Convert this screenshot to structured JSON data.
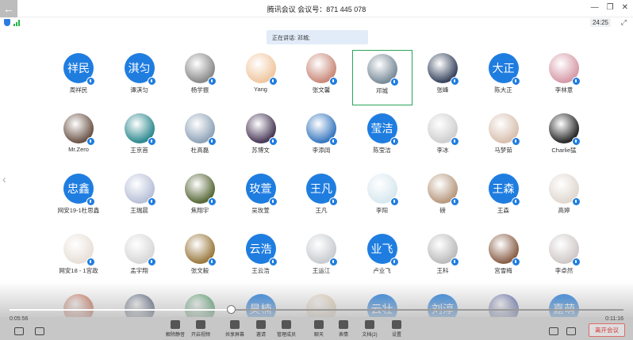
{
  "window": {
    "title": "腾讯会议 会议号：871 445 078",
    "timer": "24:25",
    "controls": [
      "—",
      "❐",
      "✕"
    ]
  },
  "speaking_banner": "正在讲话: 邓城;",
  "colors": {
    "accent": "#1f7de0",
    "active_border": "#2aa55a",
    "leave": "#d23a3a"
  },
  "participants": [
    {
      "name": "周祥民",
      "avatar_text": "祥民",
      "photo": null
    },
    {
      "name": "谭淇匀",
      "avatar_text": "淇匀",
      "photo": null
    },
    {
      "name": "杨学振",
      "avatar_text": "",
      "photo": "#8a8a8a"
    },
    {
      "name": "Yang",
      "avatar_text": "",
      "photo": "#f0c7a0"
    },
    {
      "name": "张文馨",
      "avatar_text": "",
      "photo": "#c98a7a"
    },
    {
      "name": "邓城",
      "avatar_text": "",
      "photo": "#7a8c9a",
      "active": true
    },
    {
      "name": "张峰",
      "avatar_text": "",
      "photo": "#3a4660"
    },
    {
      "name": "陈大正",
      "avatar_text": "大正",
      "photo": null
    },
    {
      "name": "李林意",
      "avatar_text": "",
      "photo": "#d69aa8"
    },
    {
      "name": "Mr.Zero",
      "avatar_text": "",
      "photo": "#6c5548"
    },
    {
      "name": "王京首",
      "avatar_text": "",
      "photo": "#2f8a90"
    },
    {
      "name": "杜高磊",
      "avatar_text": "",
      "photo": "#8fa3b8"
    },
    {
      "name": "苏博文",
      "avatar_text": "",
      "photo": "#4a3a58"
    },
    {
      "name": "李添阔",
      "avatar_text": "",
      "photo": "#3a78c0"
    },
    {
      "name": "陈莹洁",
      "avatar_text": "莹洁",
      "photo": null
    },
    {
      "name": "李冰",
      "avatar_text": "",
      "photo": "#cfcfcf"
    },
    {
      "name": "马梦茹",
      "avatar_text": "",
      "photo": "#d8c0b0"
    },
    {
      "name": "Charlie猛",
      "avatar_text": "",
      "photo": "#2a2a2a"
    },
    {
      "name": "网安19-1杜思鑫",
      "avatar_text": "忠鑫",
      "photo": null
    },
    {
      "name": "王瑞晨",
      "avatar_text": "",
      "photo": "#b8c0d8"
    },
    {
      "name": "焦翔宇",
      "avatar_text": "",
      "photo": "#5a6a3a"
    },
    {
      "name": "吴玫萱",
      "avatar_text": "玫萱",
      "photo": null
    },
    {
      "name": "王凡",
      "avatar_text": "王凡",
      "photo": null
    },
    {
      "name": "李阳",
      "avatar_text": "",
      "photo": "#d8e8f0"
    },
    {
      "name": "磅",
      "avatar_text": "",
      "photo": "#b89a80"
    },
    {
      "name": "王森",
      "avatar_text": "王森",
      "photo": null
    },
    {
      "name": "高婷",
      "avatar_text": "",
      "photo": "#e0d8d0"
    },
    {
      "name": "网安18 - 1宫政",
      "avatar_text": "",
      "photo": "#e8e0d8"
    },
    {
      "name": "孟宇翔",
      "avatar_text": "",
      "photo": "#d8d8d8"
    },
    {
      "name": "张文毅",
      "avatar_text": "",
      "photo": "#9a7a40"
    },
    {
      "name": "王云浩",
      "avatar_text": "云浩",
      "photo": null
    },
    {
      "name": "王运江",
      "avatar_text": "",
      "photo": "#c8ccd0"
    },
    {
      "name": "卢业飞",
      "avatar_text": "业飞",
      "photo": null
    },
    {
      "name": "王科",
      "avatar_text": "",
      "photo": "#bcbcbc"
    },
    {
      "name": "宫雪梅",
      "avatar_text": "",
      "photo": "#8a6048"
    },
    {
      "name": "李卓然",
      "avatar_text": "",
      "photo": "#d0c8c8"
    },
    {
      "name": "",
      "avatar_text": "",
      "photo": "#c05030"
    },
    {
      "name": "",
      "avatar_text": "",
      "photo": "#2a3a5a"
    },
    {
      "name": "",
      "avatar_text": "",
      "photo": "#2a8a4a"
    },
    {
      "name": "",
      "avatar_text": "昊楠",
      "photo": null
    },
    {
      "name": "",
      "avatar_text": "",
      "photo": "#e0c8a8"
    },
    {
      "name": "",
      "avatar_text": "云壮",
      "photo": null
    },
    {
      "name": "",
      "avatar_text": "刘淳",
      "photo": null
    },
    {
      "name": "",
      "avatar_text": "",
      "photo": "#3a4a9a"
    },
    {
      "name": "",
      "avatar_text": "嘉萌",
      "photo": null
    }
  ],
  "playback": {
    "elapsed": "0:05:56",
    "total": "0:11:16",
    "progress": 0.36
  },
  "toolbar": {
    "items": [
      {
        "label": "解除静音",
        "icon": "mic-muted-icon"
      },
      {
        "label": "开启视频",
        "icon": "camera-off-icon"
      },
      {
        "label": "共享屏幕",
        "icon": "share-screen-icon"
      },
      {
        "label": "邀请",
        "icon": "invite-icon"
      },
      {
        "label": "管理成员",
        "icon": "members-icon"
      },
      {
        "label": "聊天",
        "icon": "chat-icon"
      },
      {
        "label": "表情",
        "icon": "emoji-icon"
      },
      {
        "label": "文档(2)",
        "icon": "doc-icon"
      },
      {
        "label": "设置",
        "icon": "settings-icon"
      }
    ],
    "leave_label": "离开会议"
  }
}
